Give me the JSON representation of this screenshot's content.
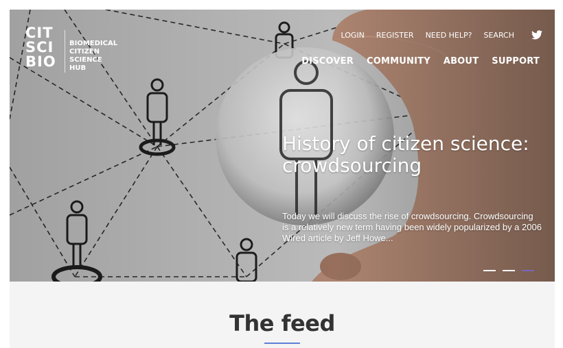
{
  "logo": {
    "mark_lines": [
      "CIT",
      "SCI",
      "BIO"
    ],
    "text_lines": [
      "BIOMEDICAL",
      "CITIZEN",
      "SCIENCE",
      "HUB"
    ]
  },
  "util_nav": [
    "LOGIN",
    "REGISTER",
    "NEED HELP?",
    "SEARCH"
  ],
  "main_nav": [
    "DISCOVER",
    "COMMUNITY",
    "ABOUT",
    "SUPPORT"
  ],
  "hero": {
    "headline": "History of citizen science: crowdsourcing",
    "excerpt": "Today we will discuss the rise of crowdsourcing. Crowdsourcing is a relatively new term having been widely popularized by a 2006 Wired article by Jeff Howe...",
    "slides": 3,
    "active_slide": 3
  },
  "feed": {
    "title": "The feed"
  },
  "colors": {
    "accent_underline": "#5b7fd6",
    "active_dot": "#7b66b8"
  }
}
